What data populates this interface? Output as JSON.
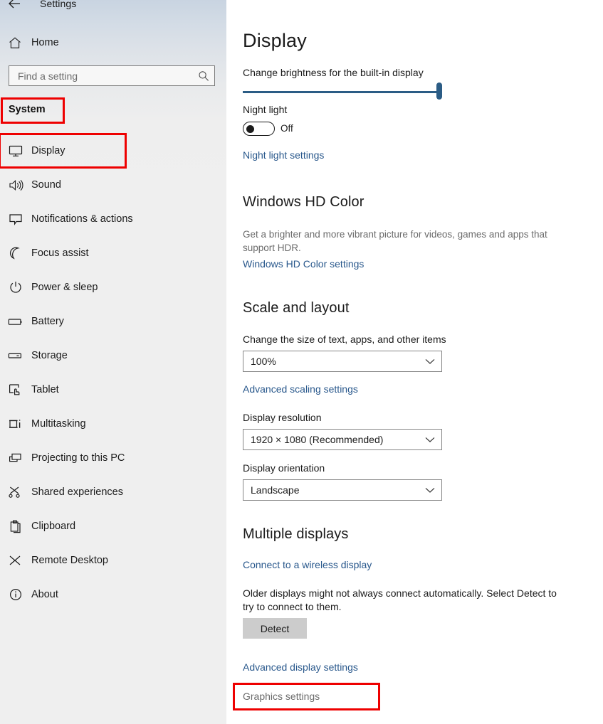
{
  "window": {
    "back_icon": "back-arrow-icon",
    "title": "Settings"
  },
  "sidebar": {
    "home": {
      "label": "Home",
      "icon": "home-icon"
    },
    "search": {
      "placeholder": "Find a setting",
      "value": "",
      "icon": "search-icon"
    },
    "section_title": "System",
    "items": [
      {
        "label": "Display",
        "icon": "monitor-icon",
        "selected": true
      },
      {
        "label": "Sound",
        "icon": "speaker-icon",
        "selected": false
      },
      {
        "label": "Notifications & actions",
        "icon": "notification-balloon-icon",
        "selected": false
      },
      {
        "label": "Focus assist",
        "icon": "moon-icon",
        "selected": false
      },
      {
        "label": "Power & sleep",
        "icon": "power-icon",
        "selected": false
      },
      {
        "label": "Battery",
        "icon": "battery-icon",
        "selected": false
      },
      {
        "label": "Storage",
        "icon": "drive-icon",
        "selected": false
      },
      {
        "label": "Tablet",
        "icon": "tablet-hand-icon",
        "selected": false
      },
      {
        "label": "Multitasking",
        "icon": "multitasking-icon",
        "selected": false
      },
      {
        "label": "Projecting to this PC",
        "icon": "projecting-icon",
        "selected": false
      },
      {
        "label": "Shared experiences",
        "icon": "share-nodes-icon",
        "selected": false
      },
      {
        "label": "Clipboard",
        "icon": "clipboard-icon",
        "selected": false
      },
      {
        "label": "Remote Desktop",
        "icon": "remote-desktop-icon",
        "selected": false
      },
      {
        "label": "About",
        "icon": "info-circle-icon",
        "selected": false
      }
    ]
  },
  "main": {
    "page_title": "Display",
    "brightness": {
      "label": "Change brightness for the built-in display",
      "value": 97
    },
    "night_light": {
      "label": "Night light",
      "state": "Off",
      "settings_link": "Night light settings"
    },
    "hd_color": {
      "heading": "Windows HD Color",
      "description": "Get a brighter and more vibrant picture for videos, games and apps that support HDR.",
      "settings_link": "Windows HD Color settings"
    },
    "scale_layout": {
      "heading": "Scale and layout",
      "scale_label": "Change the size of text, apps, and other items",
      "scale_value": "100%",
      "advanced_scaling_link": "Advanced scaling settings",
      "resolution_label": "Display resolution",
      "resolution_value": "1920 × 1080 (Recommended)",
      "orientation_label": "Display orientation",
      "orientation_value": "Landscape"
    },
    "multiple_displays": {
      "heading": "Multiple displays",
      "wireless_link": "Connect to a wireless display",
      "description": "Older displays might not always connect automatically. Select Detect to try to connect to them.",
      "detect_button": "Detect",
      "advanced_display_link": "Advanced display settings",
      "graphics_settings": "Graphics settings"
    }
  },
  "annotations": {
    "color": "#ee0000",
    "boxes": [
      "system-section-title",
      "display-sidebar-item",
      "graphics-settings"
    ]
  }
}
